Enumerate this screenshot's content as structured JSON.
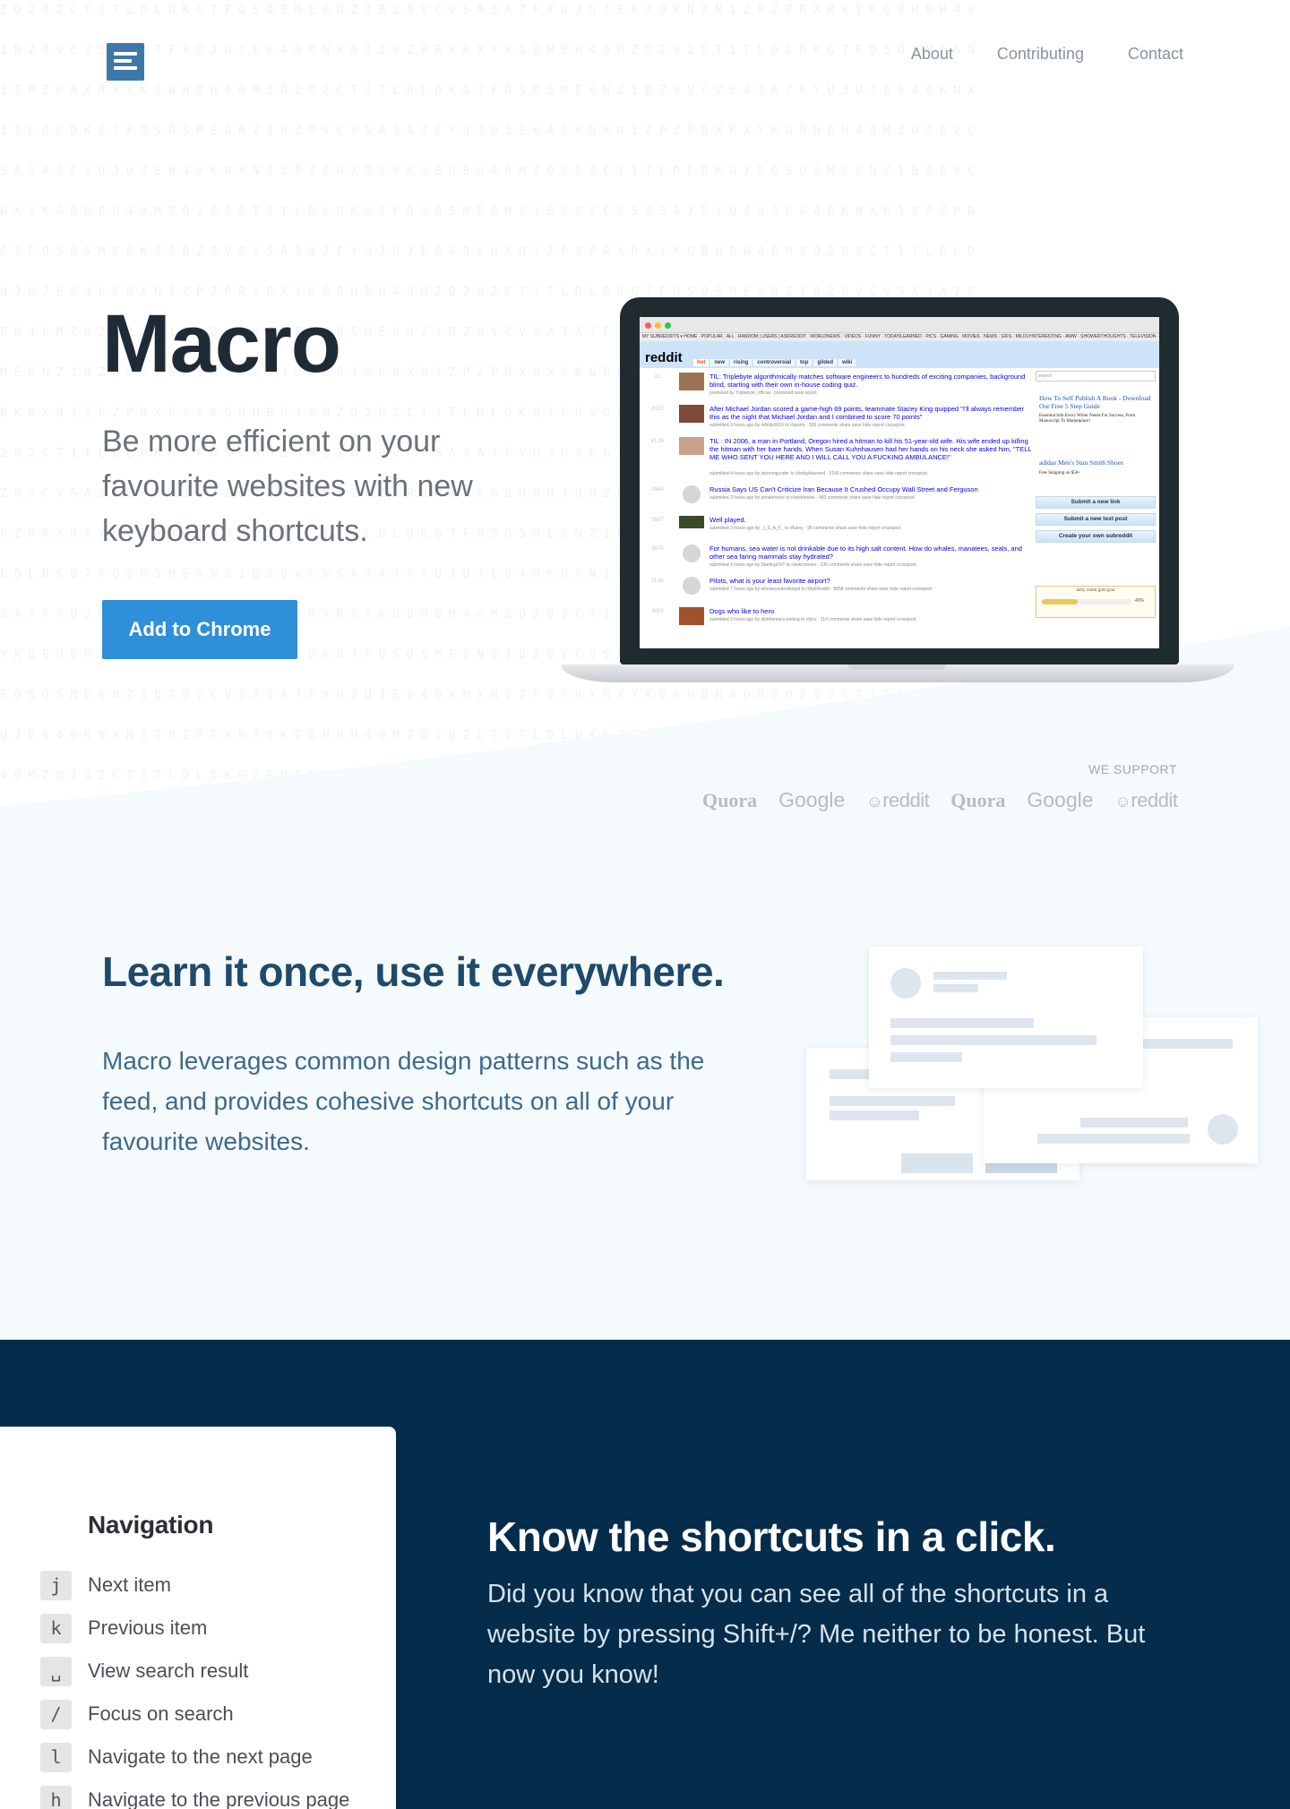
{
  "nav": {
    "logo_icon": "list-document-icon",
    "links": [
      "About",
      "Contributing",
      "Contact"
    ]
  },
  "hero": {
    "title": "Macro",
    "subtitle": "Be more efficient on your favourite websites with new keyboard shortcuts.",
    "cta_label": "Add to Chrome"
  },
  "screenshot": {
    "top_bar": "MY SUBREDDITS ▾  HOME · POPULAR · ALL · RANDOM | USERS | ASKREDDIT · WORLDNEWS · VIDEOS · FUNNY · TODAYILEARNED · PICS · GAMING · MOVIES · NEWS · GIFS · MILDLYINTERESTING · AWW · SHOWERTHOUGHTS · TELEVISION · JOKES · SCIE  EDIT ▸",
    "logo": "reddit",
    "tabs": [
      "hot",
      "new",
      "rising",
      "controversial",
      "top",
      "gilded",
      "wiki"
    ],
    "posts": [
      {
        "rank": "21",
        "title": "TIL: Triplebyte algorithmically matches software engineers to hundreds of exciting companies, background blind, starting with their own in-house coding quiz.",
        "meta": "promoted by Triplebyte_official  ·  promoted  save  report"
      },
      {
        "rank": "8101",
        "title": "After Michael Jordan scored a game-high 69 points, teammate Stacey King quipped \"I'll always remember this as the night that Michael Jordan and I combined to score 70 points\"",
        "meta": "submitted 3 hours ago by infinity0010  to r/sports  ·  336 comments  share  save  hide  report  crosspost"
      },
      {
        "rank": "61.3k",
        "title": "TIL : IN 2006, a man in Portland, Oregon hired a hitman to kill his 51-year-old wife. His wife ended up killing the hitman with her bare hands. When Susan Kuhnhausen had her hands on his neck she asked him, \"TELL ME WHO SENT YOU HERE AND I WILL CALL YOU A FUCKING AMBULANCE!\"",
        "meta": "submitted 4 hours ago by stunningcoder  to r/todayilearned  ·  3166 comments  share  save  hide  report  crosspost"
      },
      {
        "rank": "2984",
        "title": "Russia Says US Can't Criticize Iran Because It Crushed Occupy Wall Street and Ferguson",
        "meta": "submitted 3 hours ago by anniemoore  to r/worldnews  ·  483 comments  share  save  hide  report  crosspost"
      },
      {
        "rank": "3587",
        "title": "Well played.",
        "meta": "submitted 3 hours ago by _I_S_A_F_  to r/funny  ·  95 comments  share  save  hide  report  crosspost"
      },
      {
        "rank": "3975",
        "title": "For humans, sea water is not drinkable due to its high salt content. How do whales, manatees, seals, and other sea faring mammals stay hydrated?",
        "meta": "submitted 4 hours ago by StartingOnT  to r/askscience  ·  130 comments  share  save  hide  report  crosspost"
      },
      {
        "rank": "11.8k",
        "title": "Pilots, what is your least favorite airport?",
        "meta": "submitted 7 hours ago by whoiseyoulookingat  to r/AskReddit  ·  8858 comments  share  save  hide  report  crosspost"
      },
      {
        "rank": "4959",
        "title": "Dogs who like to hero",
        "meta": "submitted 3 hours ago by dickfromaccounting  to r/pics  ·  114 comments  share  save  hide  report  crosspost"
      }
    ],
    "search_placeholder": "search",
    "ad_title": "How To Self Publish A Book - Download Our Free 5 Step Guide",
    "ad_text": "Essential Info Every Writer Needs For Success, From Manuscript To Marketplace!",
    "ad2_title": "adidas Men's Stan Smith Shoes",
    "ad2_text": "Free Shipping on $50+",
    "buttons": [
      "Submit a new link",
      "Submit a new text post",
      "Create your own subreddit"
    ],
    "gold_label": "daily reddit gold goal",
    "gold_pct": "40%"
  },
  "support": {
    "label": "WE SUPPORT",
    "logos": [
      "Quora",
      "Google",
      "reddit",
      "Quora",
      "Google",
      "reddit"
    ]
  },
  "feature1": {
    "title": "Learn it once, use it everywhere.",
    "text": "Macro leverages common design patterns such as the feed, and provides cohesive shortcuts on all of your favourite websites."
  },
  "feature2": {
    "panel_heading": "Navigation",
    "shortcuts": [
      {
        "key": "j",
        "desc": "Next item"
      },
      {
        "key": "k",
        "desc": "Previous item"
      },
      {
        "key": "␣",
        "desc": "View search result"
      },
      {
        "key": "/",
        "desc": "Focus on search"
      },
      {
        "key": "l",
        "desc": "Navigate to the next page"
      },
      {
        "key": "h",
        "desc": "Navigate to the previous page"
      }
    ],
    "title": "Know the shortcuts in a click.",
    "text": "Did you know that you can see all of the shortcuts in a website by pressing Shift+/? Me neither to be honest. But now you know!"
  },
  "colors": {
    "primary": "#2f8fd9",
    "logo": "#3e78a8",
    "dark_section": "#052c4a",
    "light_section": "#f5fafd",
    "heading_blue": "#1f4a6b"
  }
}
